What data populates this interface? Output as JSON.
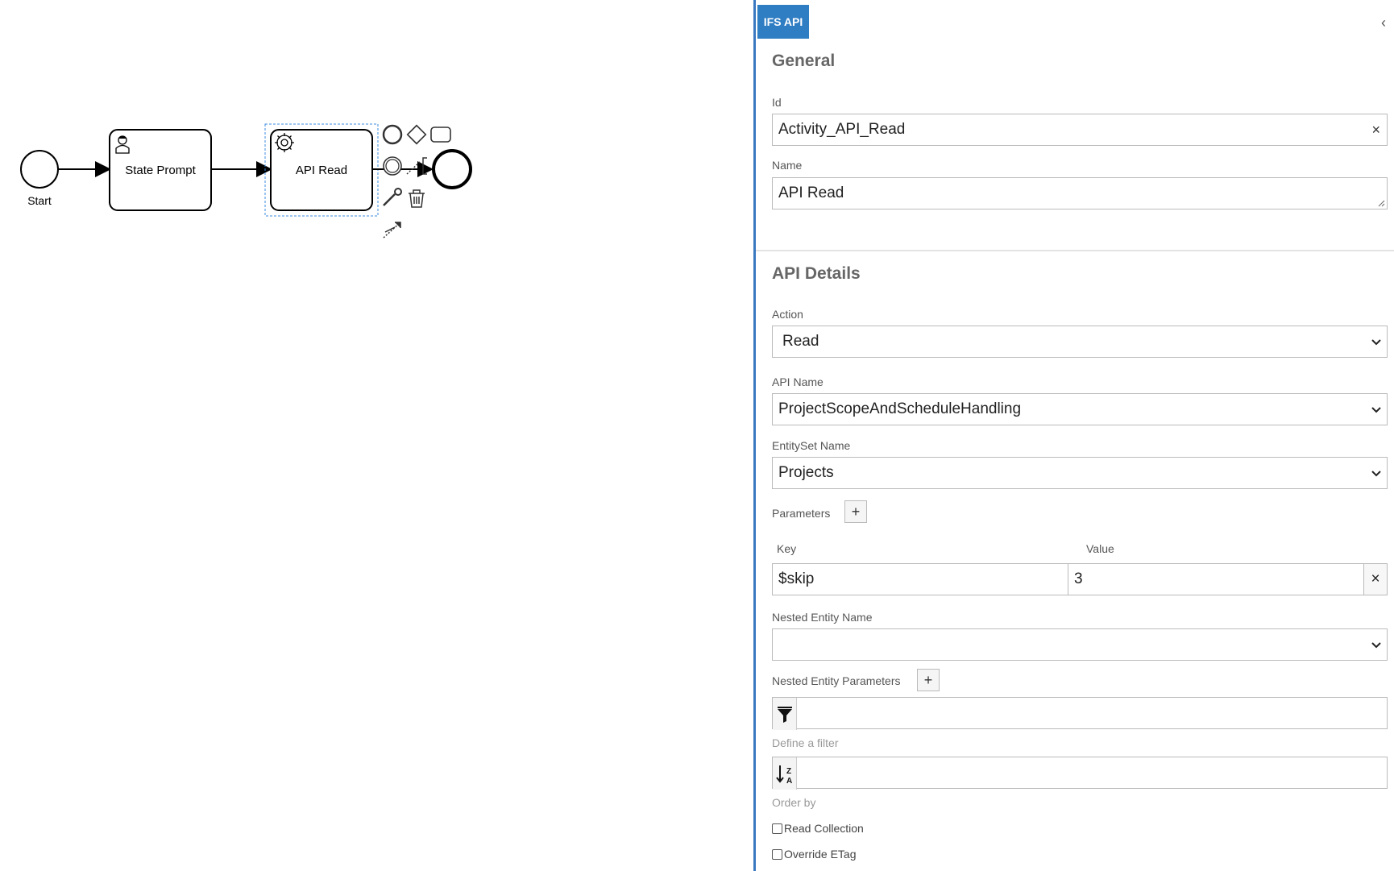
{
  "diagram": {
    "start_label": "Start",
    "task1_label": "State Prompt",
    "task2_label": "API Read"
  },
  "panel": {
    "tab_label": "IFS API",
    "collapse_icon": "‹",
    "general_title": "General",
    "id_label": "Id",
    "id_value": "Activity_API_Read",
    "name_label": "Name",
    "name_value": "API Read",
    "api_details_title": "API Details",
    "action_label": "Action",
    "action_value": "Read",
    "api_name_label": "API Name",
    "api_name_value": "ProjectScopeAndScheduleHandling",
    "entityset_label": "EntitySet Name",
    "entityset_value": "Projects",
    "parameters_label": "Parameters",
    "key_header": "Key",
    "value_header": "Value",
    "param_key": "$skip",
    "param_value": "3",
    "nested_entity_label": "Nested Entity Name",
    "nested_entity_value": "",
    "nested_params_label": "Nested Entity Parameters",
    "filter_value": "",
    "filter_hint": "Define a filter",
    "orderby_value": "",
    "orderby_hint": "Order by",
    "read_collection_label": "Read Collection",
    "override_etag_label": "Override ETag",
    "clear_symbol": "×",
    "plus_symbol": "+"
  },
  "colors": {
    "accent": "#2f7dc3",
    "panel_border": "#3b78c2",
    "selection": "#3d8ee0"
  }
}
